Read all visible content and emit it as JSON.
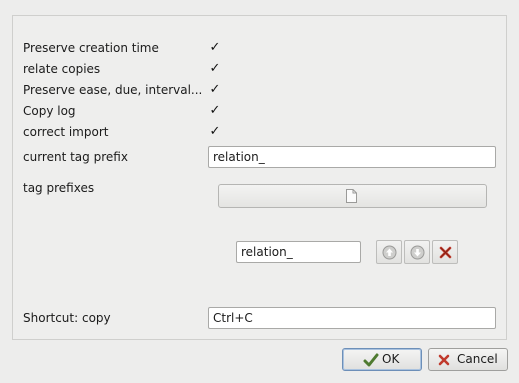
{
  "options": [
    {
      "label": "Preserve creation time",
      "checked": true
    },
    {
      "label": "relate copies",
      "checked": true
    },
    {
      "label": "Preserve ease, due, interval...",
      "checked": true
    },
    {
      "label": "Copy log",
      "checked": true
    },
    {
      "label": "correct import",
      "checked": true
    }
  ],
  "current_tag_prefix": {
    "label": "current tag prefix",
    "value": "relation_"
  },
  "tag_prefixes": {
    "label": "tag prefixes",
    "add_icon": "document-icon",
    "entry_value": "relation_",
    "buttons": [
      "arrow-up-icon",
      "arrow-down-icon",
      "delete-icon"
    ]
  },
  "shortcut": {
    "label": "Shortcut: copy",
    "value": "Ctrl+C"
  },
  "dialog_buttons": {
    "ok_label": "OK",
    "cancel_label": "Cancel"
  },
  "colors": {
    "delete_red": "#c0392b",
    "ok_green": "#5b8a3a",
    "cancel_red": "#c0392b"
  }
}
